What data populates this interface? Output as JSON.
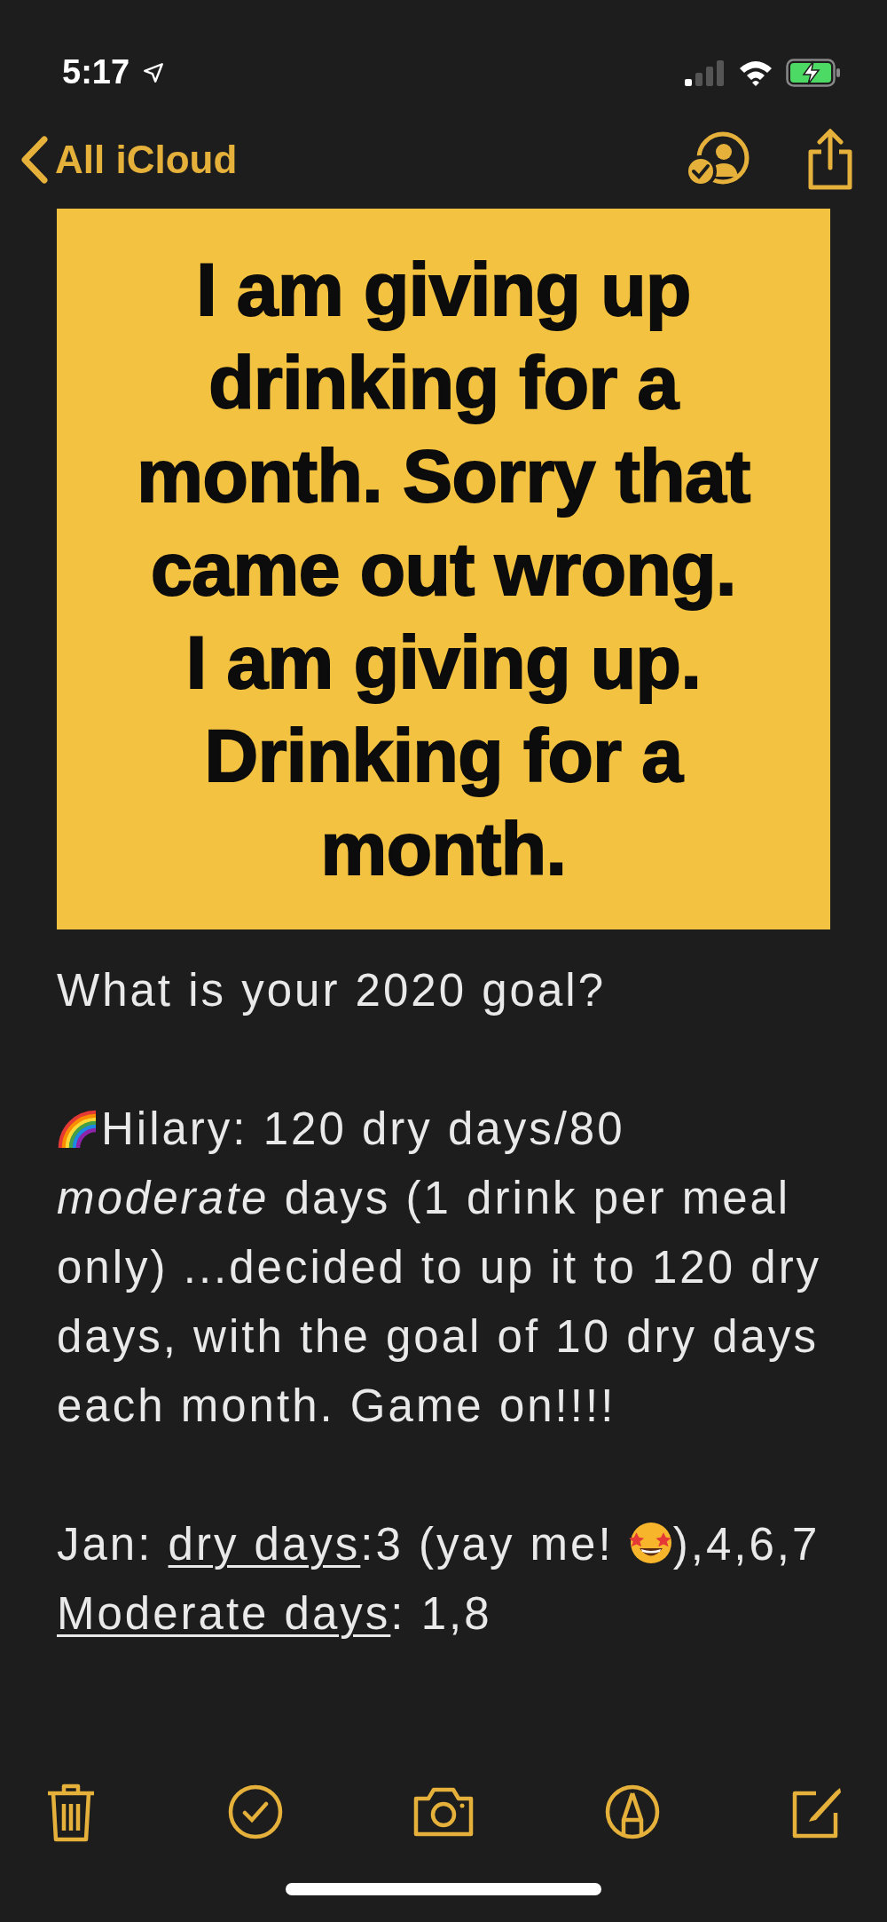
{
  "status_bar": {
    "time": "5:17"
  },
  "nav": {
    "back_label": "All iCloud"
  },
  "note": {
    "image_lines": [
      "I am giving up",
      "drinking for a",
      "month. Sorry that",
      "came out wrong.",
      "I am giving up.",
      "Drinking for a",
      "month."
    ],
    "blocks": [
      [
        {
          "segments": [
            {
              "kind": "text",
              "text": "What is your 2020 goal?"
            }
          ]
        }
      ],
      [
        {
          "segments": [
            {
              "kind": "rainbow-emoji"
            },
            {
              "kind": "text",
              "text": "Hilary: 120 dry days/80 "
            },
            {
              "kind": "italic",
              "text": "moderate"
            },
            {
              "kind": "text",
              "text": " days (1 drink per meal only) ...decided to up it to 120 dry days, with the goal of 10 dry days each month. Game on!!!!"
            }
          ]
        }
      ],
      [
        {
          "segments": [
            {
              "kind": "text",
              "text": "Jan: "
            },
            {
              "kind": "underline",
              "text": "dry days"
            },
            {
              "kind": "text",
              "text": ":3 (yay me! "
            },
            {
              "kind": "starstruck-emoji"
            },
            {
              "kind": "text",
              "text": "),4,6,7"
            }
          ]
        },
        {
          "segments": [
            {
              "kind": "underline",
              "text": "Moderate days"
            },
            {
              "kind": "text",
              "text": ": 1,8"
            }
          ]
        }
      ]
    ]
  }
}
